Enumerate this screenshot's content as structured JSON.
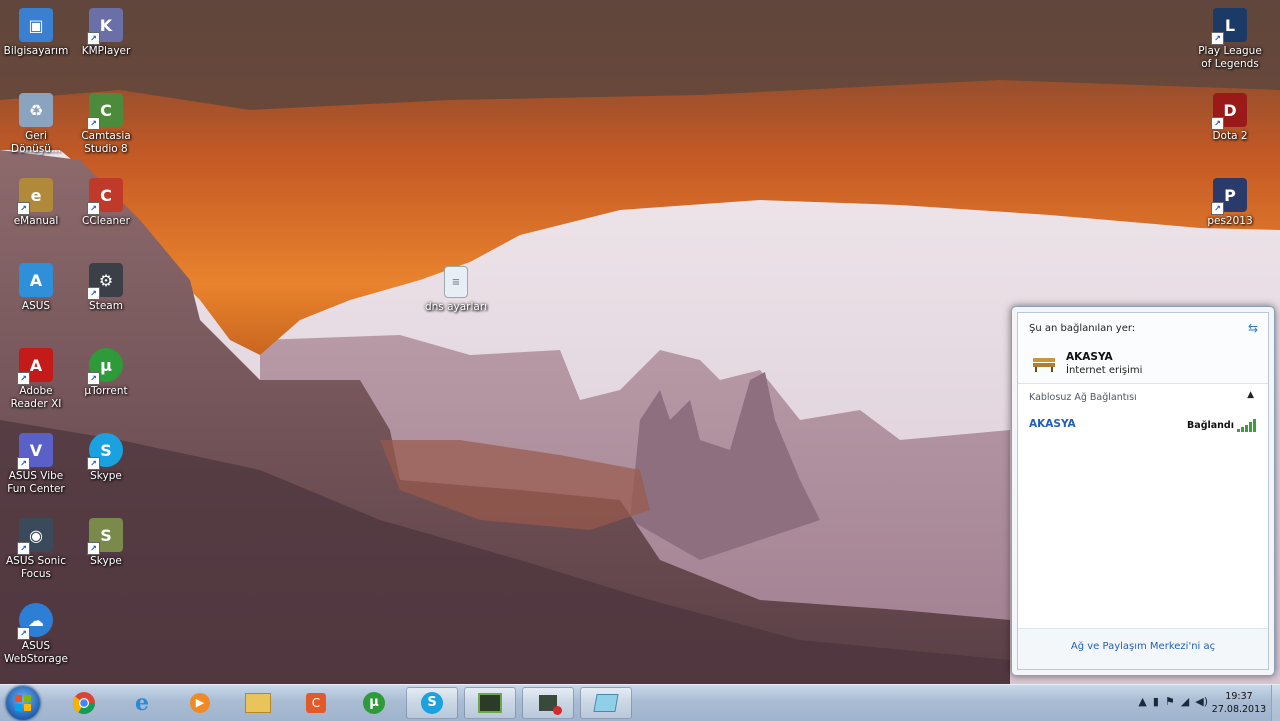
{
  "desktop_icons": [
    {
      "label": "Bilgisayarım",
      "icon": "computer-icon",
      "color": "#3a7fd0"
    },
    {
      "label": "KMPlayer",
      "icon": "kmplayer-icon",
      "color": "#6b6fa8"
    },
    {
      "label": "Geri Dönüşü...",
      "icon": "recycle-bin-icon",
      "color": "#8aa4c0"
    },
    {
      "label": "Camtasia Studio 8",
      "icon": "camtasia-icon",
      "color": "#4c8a3c"
    },
    {
      "label": "eManual",
      "icon": "emanual-icon",
      "color": "#b08a3a"
    },
    {
      "label": "CCleaner",
      "icon": "ccleaner-icon",
      "color": "#c03a2a"
    },
    {
      "label": "ASUS",
      "icon": "asus-icon",
      "color": "#2f8fd8"
    },
    {
      "label": "Steam",
      "icon": "steam-icon",
      "color": "#3b3f48"
    },
    {
      "label": "Adobe Reader XI",
      "icon": "adobe-reader-icon",
      "color": "#c41a1a"
    },
    {
      "label": "µTorrent",
      "icon": "utorrent-icon",
      "color": "#2e9a3a"
    },
    {
      "label": "ASUS Vibe Fun Center",
      "icon": "asus-vibe-icon",
      "color": "#5a60c8"
    },
    {
      "label": "Skype",
      "icon": "skype-icon",
      "color": "#1aa1e0"
    },
    {
      "label": "ASUS Sonic Focus",
      "icon": "asus-sonic-focus-icon",
      "color": "#3a4a5a"
    },
    {
      "label": "Skype",
      "icon": "skype-shortcut-icon",
      "color": "#7a8a4a"
    },
    {
      "label": "ASUS WebStorage",
      "icon": "asus-webstorage-icon",
      "color": "#2d7fd6"
    },
    {
      "label": "Play League of Legends",
      "icon": "league-of-legends-icon",
      "color": "#1c3a66"
    },
    {
      "label": "Dota 2",
      "icon": "dota2-icon",
      "color": "#9a1a1a"
    },
    {
      "label": "pes2013",
      "icon": "pes2013-icon",
      "color": "#2a3a6a"
    },
    {
      "label": "dns ayarları",
      "icon": "text-file-icon",
      "color": "#e8eef5"
    }
  ],
  "network_flyout": {
    "current_label": "Şu an bağlanılan yer:",
    "network_name": "AKASYA",
    "network_status": "İnternet erişimi",
    "group_label": "Kablosuz Ağ Bağlantısı",
    "item_name": "AKASYA",
    "item_status": "Bağlandı",
    "footer_link": "Ağ ve Paylaşım Merkezi'ni aç"
  },
  "taskbar": {
    "pinned": [
      {
        "icon": "chrome-icon",
        "active": false
      },
      {
        "icon": "internet-explorer-icon",
        "active": false
      },
      {
        "icon": "media-player-icon",
        "active": false
      },
      {
        "icon": "file-explorer-icon",
        "active": false
      },
      {
        "icon": "camtasia-taskbar-icon",
        "active": false
      },
      {
        "icon": "utorrent-taskbar-icon",
        "active": false
      },
      {
        "icon": "skype-taskbar-icon",
        "active": true
      },
      {
        "icon": "green-app-icon",
        "active": true
      },
      {
        "icon": "recorder-icon",
        "active": true
      },
      {
        "icon": "notepad-icon",
        "active": true
      }
    ],
    "clock_time": "19:37",
    "clock_date": "27.08.2013"
  },
  "colors": {
    "accent_link": "#1f5fb8",
    "taskbar_top": "#c9d8ea",
    "signal_green": "#3aa03a"
  }
}
